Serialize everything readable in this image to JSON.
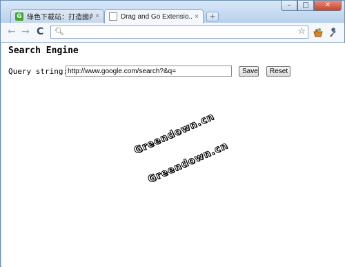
{
  "window": {
    "controls": {
      "minimize": "–",
      "maximize": "□",
      "close": "✕"
    }
  },
  "tabs": [
    {
      "label": "綠色下載站：打造國內第...",
      "favicon": "G",
      "close": "×",
      "active": false
    },
    {
      "label": "Drag and Go Extensio...",
      "close": "×",
      "active": true
    }
  ],
  "new_tab": "+",
  "toolbar": {
    "back": "←",
    "forward": "→",
    "reload": "C",
    "address_value": "",
    "search_icon": "magnifier-icon",
    "star_icon": "star-icon",
    "extension_icons": [
      "basket-icon",
      "wrench-icon"
    ]
  },
  "page": {
    "heading": "Search Engine",
    "query_label": "Query string:",
    "query_value": "http://www.google.com/search?&q=",
    "save_label": "Save",
    "reset_label": "Reset"
  },
  "watermarks": [
    "Greendown.cn",
    "Greendown.cn"
  ]
}
